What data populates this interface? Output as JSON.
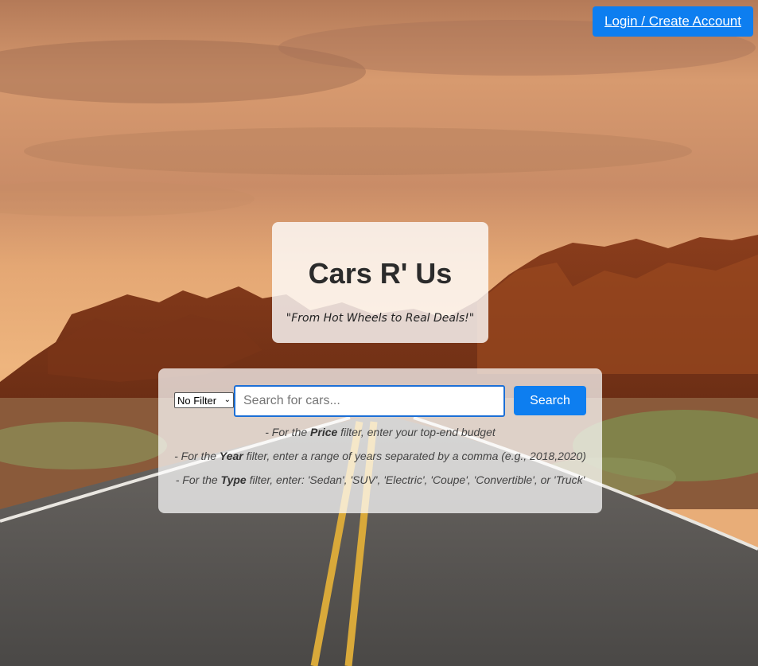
{
  "header": {
    "login_label": "Login / Create Account"
  },
  "hero": {
    "title": "Cars R' Us",
    "tagline": "\"From Hot Wheels to Real Deals!\""
  },
  "search": {
    "filter_selected": "No Filter",
    "placeholder": "Search for cars...",
    "value": "",
    "button_label": "Search"
  },
  "hints": [
    {
      "prefix": "- For the ",
      "keyword": "Price",
      "suffix": " filter, enter your top-end budget"
    },
    {
      "prefix": "- For the ",
      "keyword": "Year",
      "suffix": " filter, enter a range of years separated by a comma (e.g., 2018,2020)"
    },
    {
      "prefix": "- For the ",
      "keyword": "Type",
      "suffix": " filter, enter: 'Sedan', 'SUV', 'Electric', 'Coupe', 'Convertible', or 'Truck'"
    }
  ],
  "icons": {
    "select_chevron": "chevron-down-icon"
  },
  "colors": {
    "accent": "#0d7ef0",
    "input_border": "#1c6fd6"
  }
}
